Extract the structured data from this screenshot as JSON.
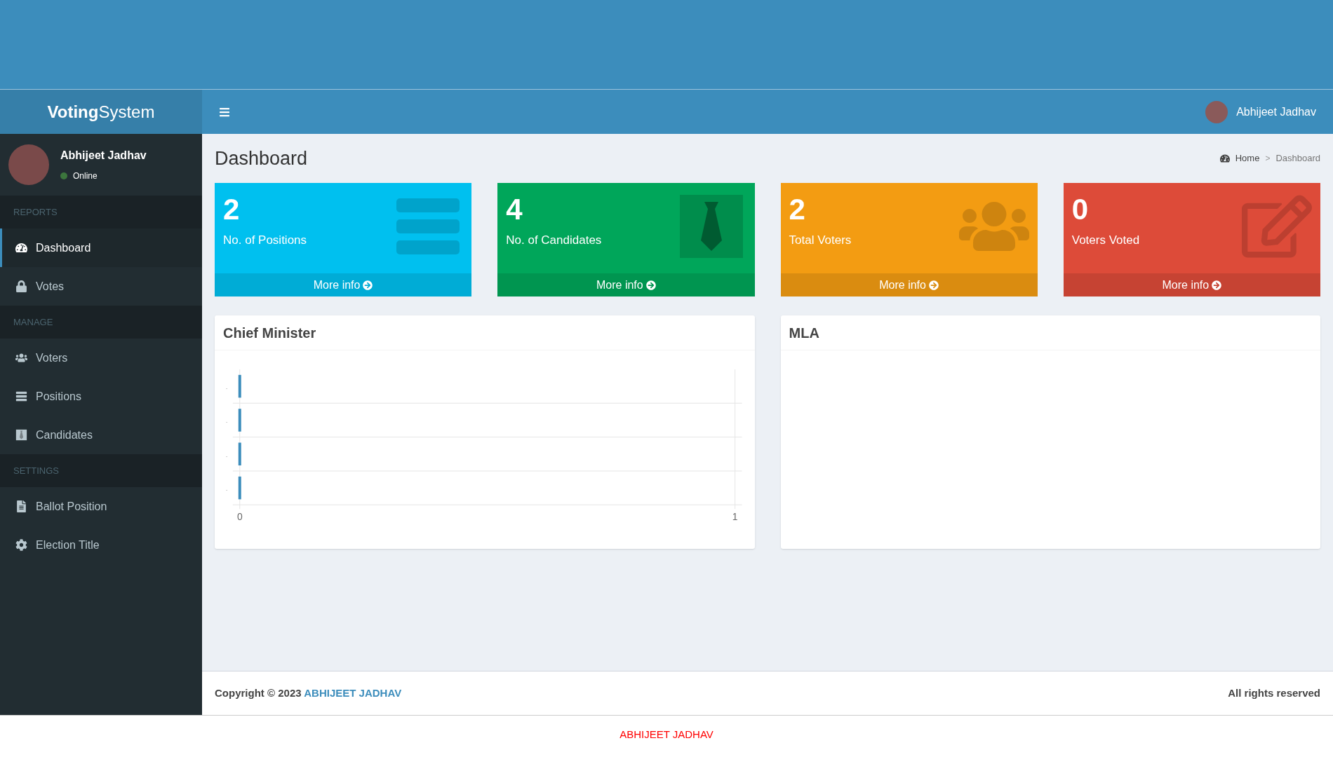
{
  "brand": {
    "bold": "Voting",
    "rest": "System"
  },
  "user": {
    "name": "Abhijeet Jadhav",
    "status": "Online"
  },
  "navbar": {
    "user_name": "Abhijeet Jadhav"
  },
  "sidebar": {
    "sections": [
      {
        "header": "REPORTS",
        "items": [
          {
            "label": "Dashboard",
            "selected": true
          },
          {
            "label": "Votes",
            "selected": false
          }
        ]
      },
      {
        "header": "MANAGE",
        "items": [
          {
            "label": "Voters",
            "selected": false
          },
          {
            "label": "Positions",
            "selected": false
          },
          {
            "label": "Candidates",
            "selected": false
          }
        ]
      },
      {
        "header": "SETTINGS",
        "items": [
          {
            "label": "Ballot Position",
            "selected": false
          },
          {
            "label": "Election Title",
            "selected": false
          }
        ]
      }
    ]
  },
  "page": {
    "title": "Dashboard",
    "breadcrumb": [
      "Home",
      "Dashboard"
    ],
    "breadcrumb_separator": ">"
  },
  "stats": [
    {
      "value": "2",
      "label": "No. of Positions",
      "link": "More info",
      "color": "#00c0ef"
    },
    {
      "value": "4",
      "label": "No. of Candidates",
      "link": "More info",
      "color": "#00a65a"
    },
    {
      "value": "2",
      "label": "Total Voters",
      "link": "More info",
      "color": "#f39c12"
    },
    {
      "value": "0",
      "label": "Voters Voted",
      "link": "More info",
      "color": "#dd4b39"
    }
  ],
  "panels": [
    {
      "title": "Chief Minister",
      "chart_data": {
        "type": "bar",
        "orientation": "horizontal",
        "categories": [
          ".",
          ".",
          ".",
          "."
        ],
        "values": [
          0,
          0,
          0,
          0
        ],
        "xlim": [
          0,
          1
        ],
        "xticks": [
          0,
          1
        ]
      }
    },
    {
      "title": "MLA"
    }
  ],
  "footer": {
    "copyright": "Copyright © 2023",
    "author": "ABHIJEET JADHAV",
    "rights": "All rights reserved"
  },
  "credit": "ABHIJEET JADHAV"
}
